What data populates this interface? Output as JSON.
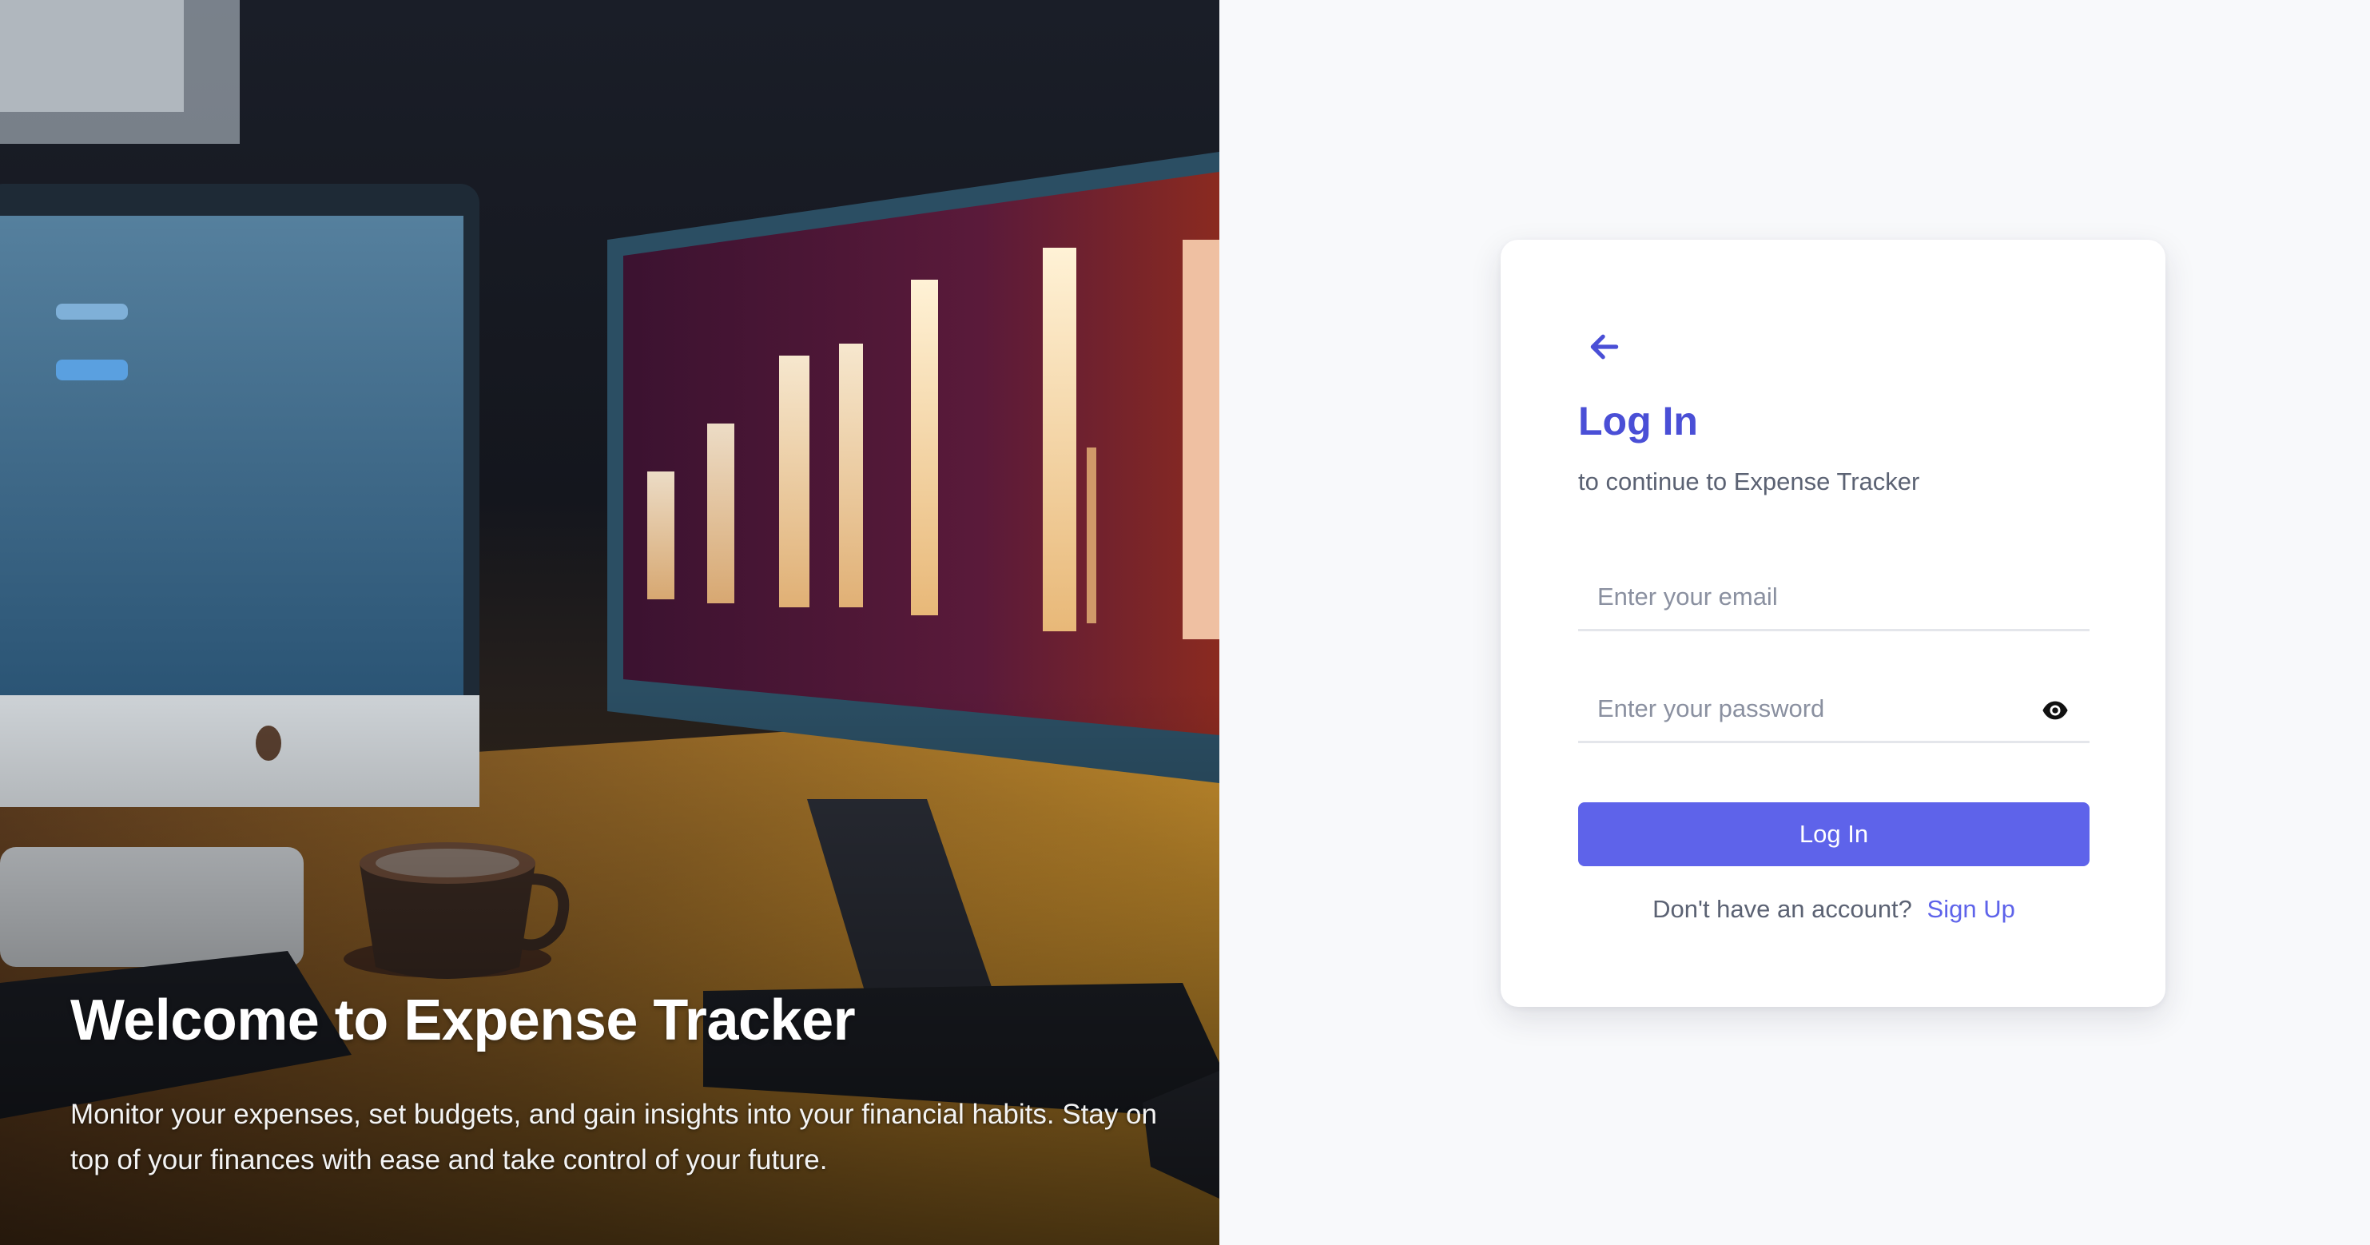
{
  "hero": {
    "title": "Welcome to Expense Tracker",
    "description": "Monitor your expenses, set budgets, and gain insights into your financial habits. Stay on top of your finances with ease and take control of your future."
  },
  "login": {
    "back_icon": "arrow-left-icon",
    "title": "Log In",
    "subtitle": "to continue to Expense Tracker",
    "email_placeholder": "Enter your email",
    "email_value": "",
    "password_placeholder": "Enter your password",
    "password_value": "",
    "eye_icon": "eye-icon",
    "submit_label": "Log In",
    "signup_prompt": "Don't have an account?",
    "signup_link": "Sign Up"
  },
  "colors": {
    "accent": "#5e63ea",
    "title": "#4a4fd6",
    "muted_text": "#5b6273",
    "page_bg": "#f8f9fb",
    "card_bg": "#ffffff"
  }
}
